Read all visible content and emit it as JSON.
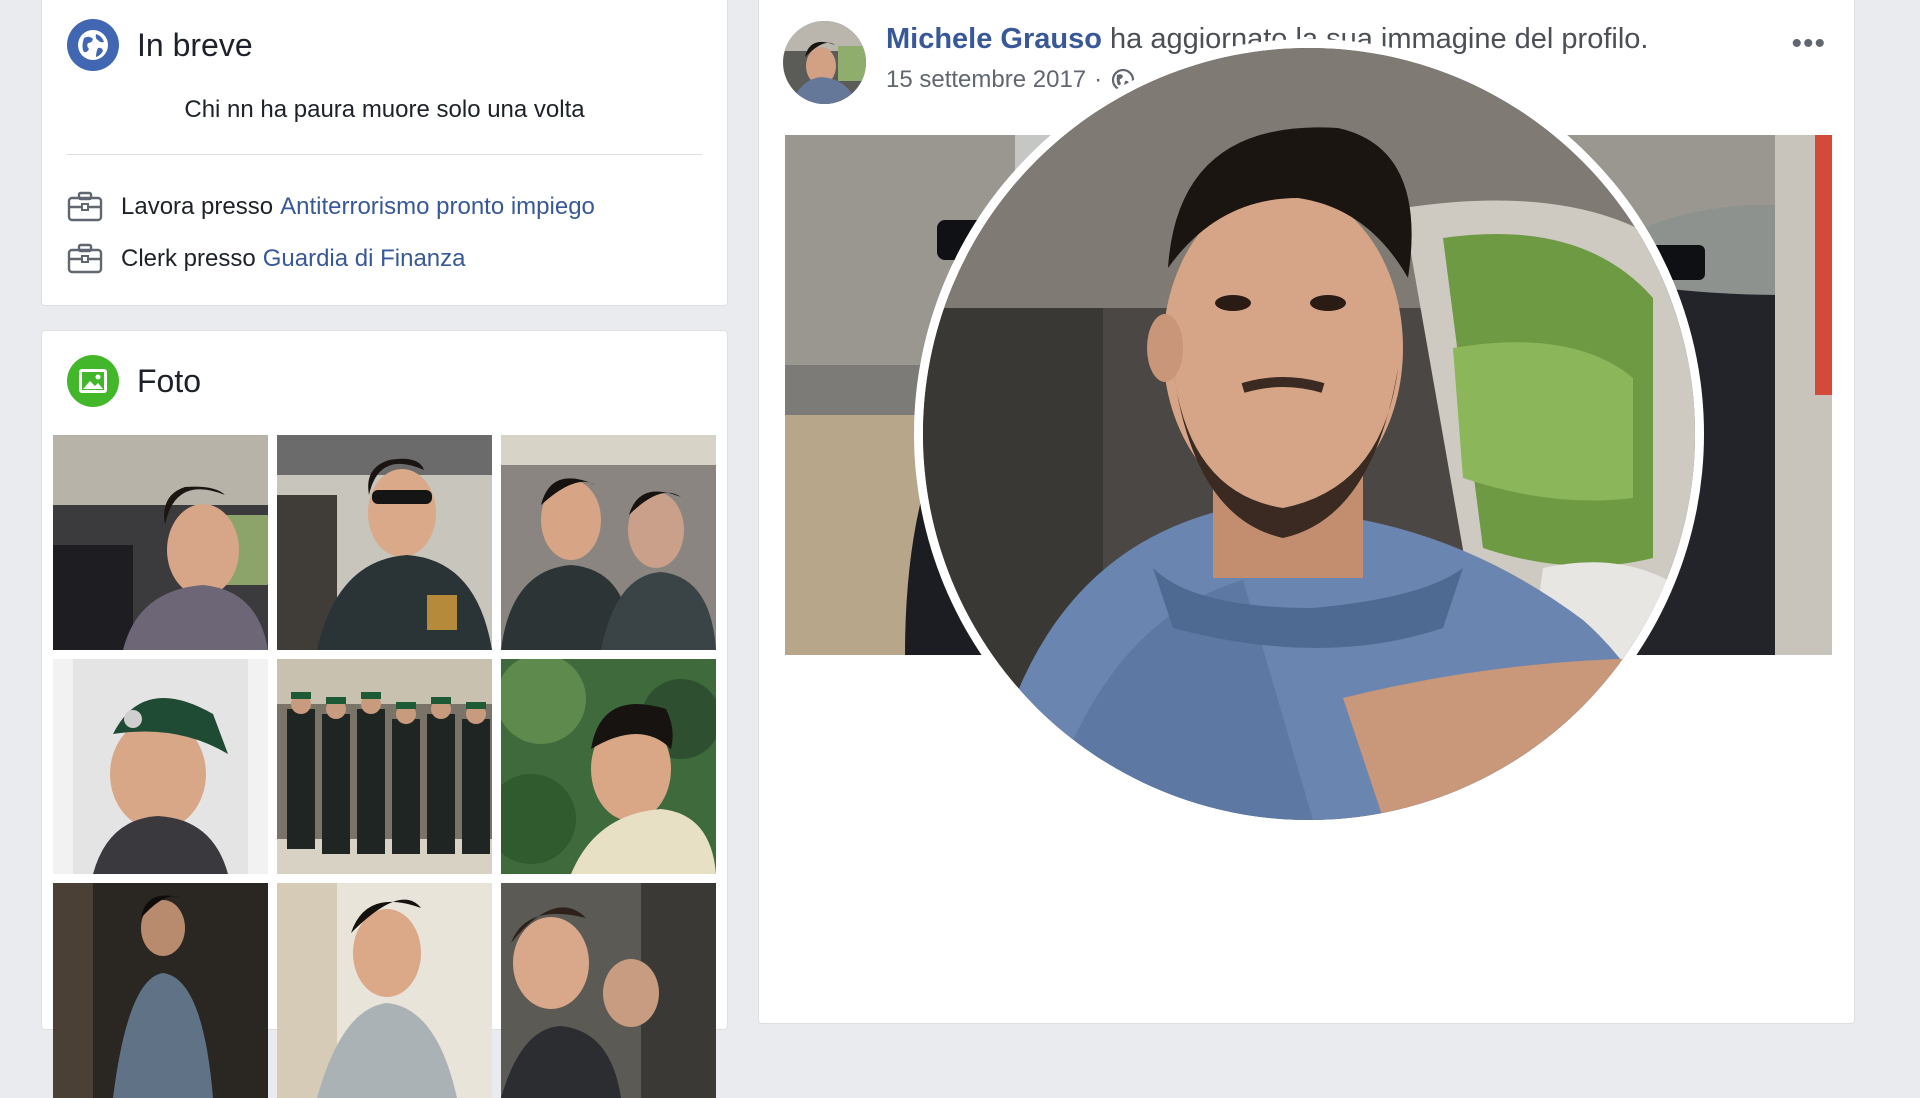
{
  "intro": {
    "title": "In breve",
    "bio": "Chi nn ha paura muore solo una volta",
    "work": [
      {
        "prefix": "Lavora presso",
        "link": "Antiterrorismo pronto impiego"
      },
      {
        "prefix": "Clerk presso",
        "link": "Guardia di Finanza"
      }
    ]
  },
  "photos": {
    "title": "Foto",
    "count_visible": 9
  },
  "post": {
    "author": "Michele Grauso",
    "action": "ha aggiornato la sua immagine del profilo.",
    "date": "15 settembre 2017",
    "separator": "·",
    "options_label": "•••"
  },
  "colors": {
    "intro_icon": "#4267b2",
    "photos_icon": "#42b72a",
    "link": "#385898"
  },
  "icons": {
    "intro": "globe-icon",
    "photos": "image-icon",
    "work": "briefcase-icon",
    "privacy": "globe-icon",
    "options": "more-options-icon"
  }
}
